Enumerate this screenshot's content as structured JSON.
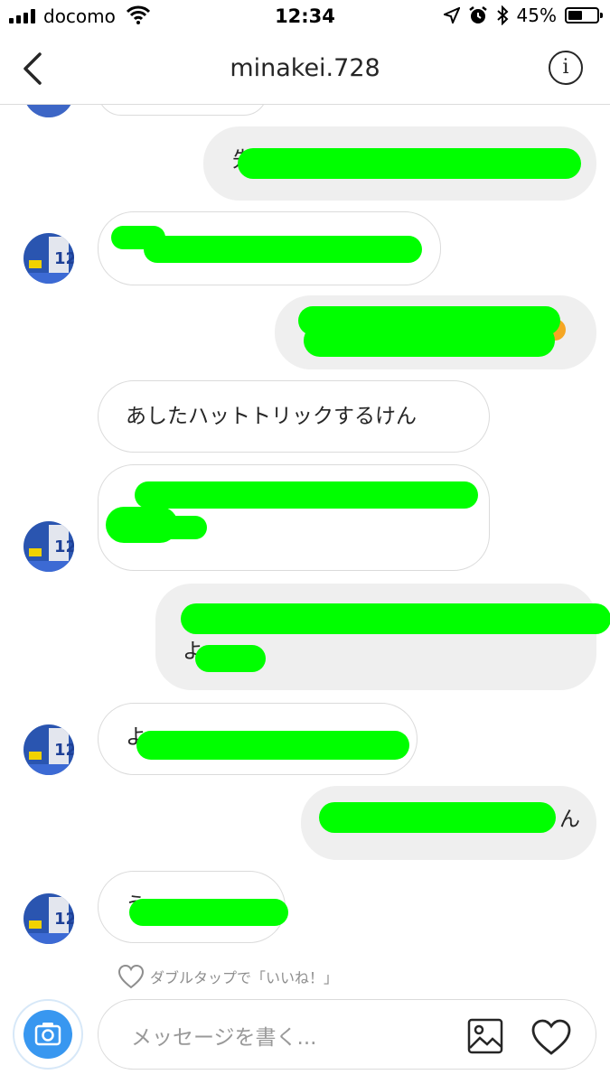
{
  "status_bar": {
    "carrier": "docomo",
    "time": "12:34",
    "battery": "45%"
  },
  "header": {
    "title": "minakei.728",
    "info_glyph": "i"
  },
  "messages": [
    {
      "side": "in",
      "text": ""
    },
    {
      "side": "out",
      "text": "先"
    },
    {
      "side": "in",
      "text": ""
    },
    {
      "side": "out",
      "text": ""
    },
    {
      "side": "in",
      "text": "あしたハットトリックするけん"
    },
    {
      "side": "in",
      "text": ""
    },
    {
      "side": "out",
      "text": "よ"
    },
    {
      "side": "in",
      "text": "よ"
    },
    {
      "side": "out",
      "text": "ん"
    },
    {
      "side": "in",
      "text": "う"
    }
  ],
  "like_hint": "ダブルタップで「いいね！」",
  "composer": {
    "placeholder": "メッセージを書く..."
  },
  "icons": [
    "back-chevron-icon",
    "info-icon",
    "camera-icon",
    "gallery-icon",
    "heart-icon",
    "wifi-icon",
    "location-icon",
    "alarm-icon",
    "bluetooth-icon",
    "battery-icon"
  ],
  "colors": {
    "redaction": "#00ff00",
    "accent": "#3897f0",
    "outgoing_bubble": "#efefef"
  }
}
